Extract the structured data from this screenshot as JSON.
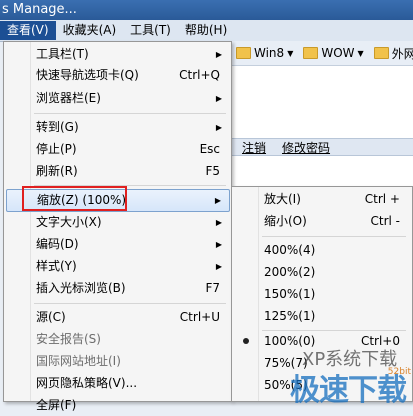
{
  "window": {
    "title": "s Manage..."
  },
  "menubar": {
    "items": [
      {
        "label": "查看(V)",
        "active": true
      },
      {
        "label": "收藏夹(A)",
        "active": false
      },
      {
        "label": "工具(T)",
        "active": false
      },
      {
        "label": "帮助(H)",
        "active": false
      }
    ]
  },
  "favorites": [
    {
      "label": "Win8"
    },
    {
      "label": "WOW"
    },
    {
      "label": "外网"
    }
  ],
  "page_links": [
    "注销",
    "修改密码"
  ],
  "view_menu": {
    "items": [
      {
        "label": "工具栏(T)",
        "submenu": true
      },
      {
        "label": "快速导航选项卡(Q)",
        "shortcut": "Ctrl+Q"
      },
      {
        "label": "浏览器栏(E)",
        "submenu": true
      },
      {
        "label": "转到(G)",
        "submenu": true
      },
      {
        "label": "停止(P)",
        "shortcut": "Esc"
      },
      {
        "label": "刷新(R)",
        "shortcut": "F5"
      },
      {
        "label": "缩放(Z) (100%)",
        "submenu": true,
        "highlighted": true
      },
      {
        "label": "文字大小(X)",
        "submenu": true
      },
      {
        "label": "编码(D)",
        "submenu": true
      },
      {
        "label": "样式(Y)",
        "submenu": true
      },
      {
        "label": "插入光标浏览(B)",
        "shortcut": "F7"
      },
      {
        "label": "源(C)",
        "shortcut": "Ctrl+U"
      },
      {
        "label": "安全报告(S)",
        "disabled": true
      },
      {
        "label": "国际网站地址(I)",
        "disabled": true
      },
      {
        "label": "网页隐私策略(V)..."
      },
      {
        "label": "全屏(F)"
      }
    ]
  },
  "zoom_menu": {
    "items": [
      {
        "label": "放大(I)",
        "shortcut": "Ctrl +"
      },
      {
        "label": "缩小(O)",
        "shortcut": "Ctrl -"
      },
      {
        "label": "400%(4)"
      },
      {
        "label": "200%(2)"
      },
      {
        "label": "150%(1)"
      },
      {
        "label": "125%(1)"
      },
      {
        "label": "100%(0)",
        "shortcut": "Ctrl+0",
        "selected": true
      },
      {
        "label": "75%(7)"
      },
      {
        "label": "50%(5)"
      }
    ]
  },
  "watermark": {
    "line1": "XP系统下载",
    "line2": "极速下载",
    "line3": "52bit"
  }
}
